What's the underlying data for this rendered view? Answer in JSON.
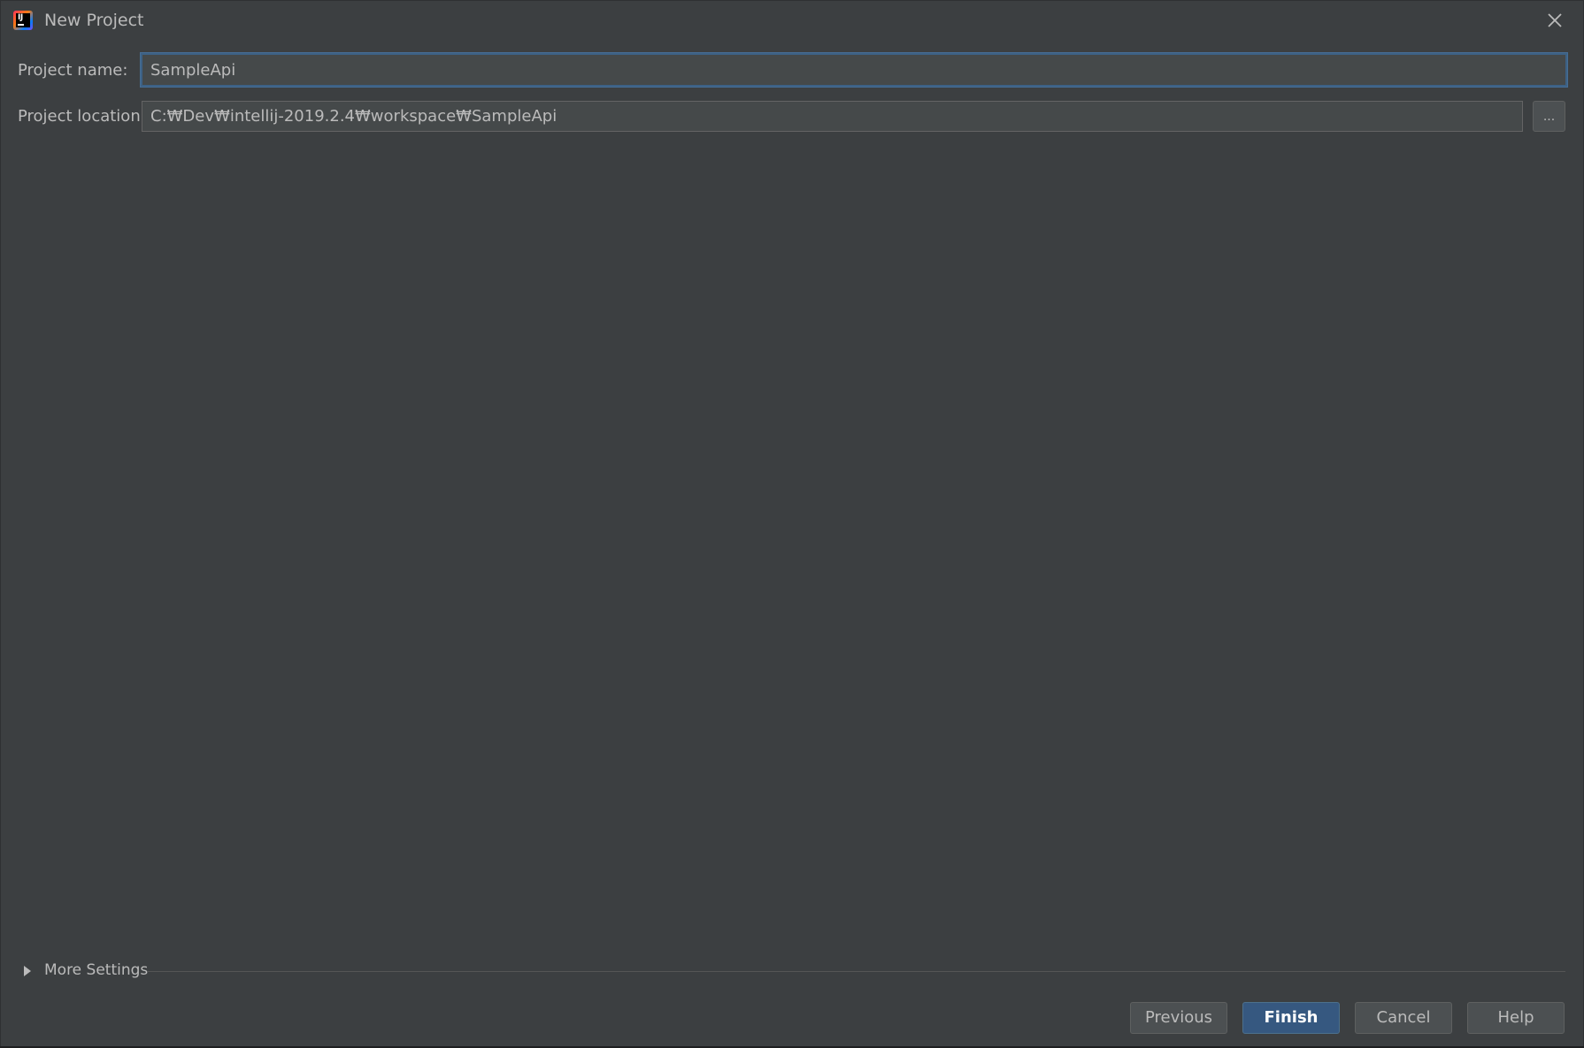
{
  "window": {
    "title": "New Project",
    "app_icon_text": "IJ",
    "close_icon": "close-icon"
  },
  "form": {
    "project_name_label": "Project name:",
    "project_name_value": "SampleApi",
    "project_location_label": "Project location:",
    "project_location_value": "C:₩Dev₩intellij-2019.2.4₩workspace₩SampleApi",
    "browse_label": "..."
  },
  "more_settings": {
    "label": "More Settings",
    "icon": "triangle-right-icon"
  },
  "buttons": {
    "previous": "Previous",
    "finish": "Finish",
    "cancel": "Cancel",
    "help": "Help"
  },
  "colors": {
    "background": "#3c3f41",
    "input_background": "#45494a",
    "focus_border": "#3d6185",
    "primary_button": "#365880",
    "text": "#bbbbbb"
  }
}
